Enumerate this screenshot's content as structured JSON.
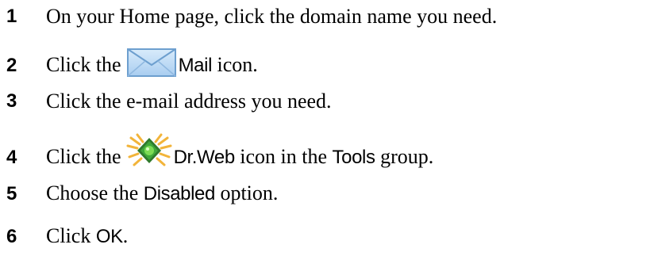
{
  "steps": [
    {
      "number": "1",
      "text": "On your Home page, click the domain name you need."
    },
    {
      "number": "2",
      "before": "Click the",
      "icon": "mail-envelope-icon",
      "ui_label": "Mail",
      "after": "icon."
    },
    {
      "number": "3",
      "text": "Click the e-mail address you need."
    },
    {
      "number": "4",
      "before": "Click the",
      "icon": "drweb-antivirus-icon",
      "ui_label": "Dr.Web",
      "middle": "icon in the",
      "ui_label_2": "Tools",
      "after": "group."
    },
    {
      "number": "5",
      "before": "Choose the",
      "ui_label": "Disabled",
      "after": "option."
    },
    {
      "number": "6",
      "before": "Click",
      "ui_label": "OK",
      "after": "."
    }
  ],
  "colors": {
    "text": "#000000",
    "envelope_fill": "#bcd9f5",
    "envelope_stroke": "#6d9fcf",
    "drweb_core": "#3fa83a",
    "drweb_halo": "#f2b43a"
  }
}
